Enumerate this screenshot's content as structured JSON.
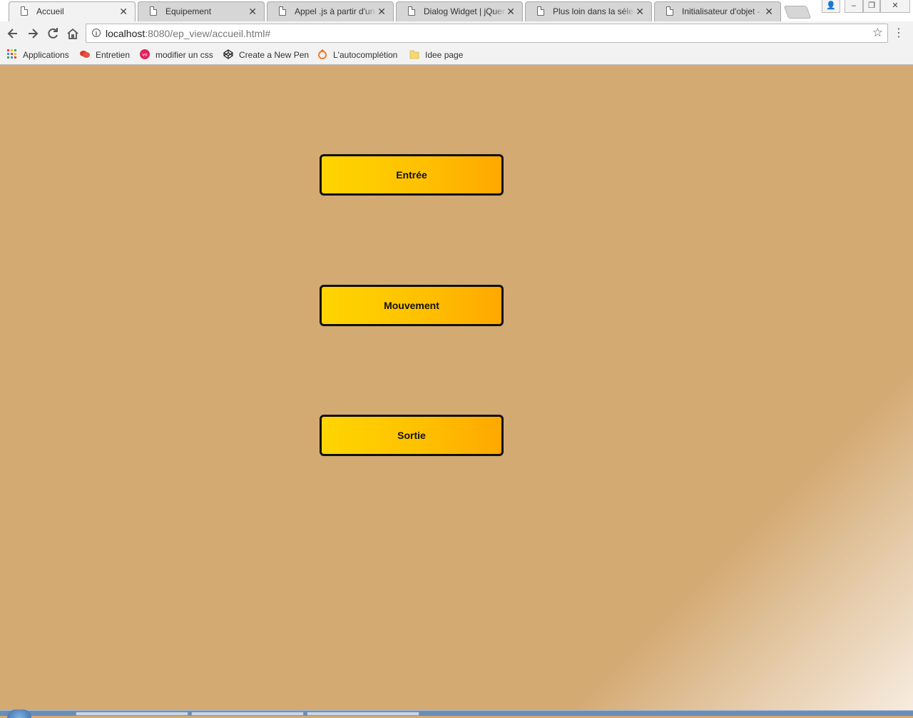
{
  "browser": {
    "tabs": [
      {
        "title": "Accueil",
        "active": true
      },
      {
        "title": "Equipement",
        "active": false
      },
      {
        "title": "Appel .js à partir d'un j",
        "active": false
      },
      {
        "title": "Dialog Widget | jQuery",
        "active": false
      },
      {
        "title": "Plus loin dans la sélect",
        "active": false
      },
      {
        "title": "Initialisateur d'objet - J",
        "active": false
      }
    ],
    "tab_close_glyph": "✕",
    "window_controls": {
      "user": "👤",
      "minimize": "–",
      "restore": "❐",
      "close": "✕"
    },
    "url": {
      "host": "localhost",
      "rest": ":8080/ep_view/accueil.html#"
    },
    "bookmarks": [
      {
        "label": "Applications",
        "icon": "apps-grid-icon"
      },
      {
        "label": "Entretien",
        "icon": "chat-bubble-icon"
      },
      {
        "label": "modifier un css",
        "icon": "vo-logo-icon"
      },
      {
        "label": "Create a New Pen",
        "icon": "codepen-icon"
      },
      {
        "label": "L'autocomplétion",
        "icon": "openclassrooms-icon"
      },
      {
        "label": "Idee page",
        "icon": "folder-icon"
      }
    ]
  },
  "page": {
    "buttons": [
      {
        "label": "Entrée"
      },
      {
        "label": "Mouvement"
      },
      {
        "label": "Sortie"
      }
    ]
  },
  "colors": {
    "page_background": "#d4aa73",
    "button_gradient_start": "#ffd500",
    "button_gradient_end": "#ffa800",
    "button_border": "#111111"
  }
}
